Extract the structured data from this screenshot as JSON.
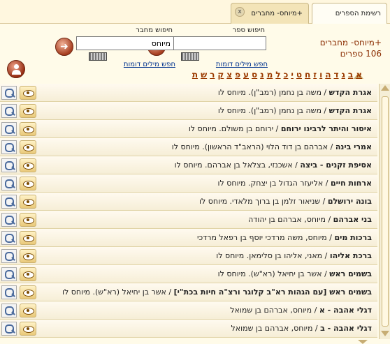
{
  "tabs": [
    {
      "label": "רשימת הספרים"
    },
    {
      "label": "+מיוחס- מחברים",
      "close": "x"
    }
  ],
  "header": {
    "collection_title": "+מיוחס- מחברים",
    "collection_count": "106 ספרים"
  },
  "book_search": {
    "label": "חיפוש ספר",
    "value": "",
    "similar_link": "חפש מילים דומות"
  },
  "author_search": {
    "label": "חיפוש מחבר",
    "value": "מיוחס",
    "similar_link": "חפש מילים דומות"
  },
  "alphabet": [
    "א",
    "ב",
    "ג",
    "ד",
    "ה",
    "ו",
    "ז",
    "ח",
    "ט",
    "י",
    "כ",
    "ל",
    "מ",
    "נ",
    "ס",
    "ע",
    "פ",
    "צ",
    "ק",
    "ר",
    "ש",
    "ת"
  ],
  "rows": [
    {
      "title": "אגרת הקדש",
      "rest": " / משה בן נחמן (רמב\"ן). מיוחס לו"
    },
    {
      "title": "אגרת הקדש",
      "rest": " / משה בן נחמן (רמב\"ן). מיוחס לו"
    },
    {
      "title": "איסור והיתר לרבינו ירוחם",
      "rest": " / ירוחם בן משולם. מיוחס לו"
    },
    {
      "title": "אמרי בינה",
      "rest": " / אברהם בן דוד הלוי (הראב\"ד הראשון). מיוחס לו"
    },
    {
      "title": "אסיפת זקנים - ביצה",
      "rest": " / אשכנזי, בצלאל בן אברהם. מיוחס לו"
    },
    {
      "title": "ארחות חיים",
      "rest": " / אליעזר הגדול בן יצחק. מיוחס לו"
    },
    {
      "title": "בונה ירושלם",
      "rest": " / שניאור זלמן בן ברוך מלאדי. מיוחס לו"
    },
    {
      "title": "בני אברהם",
      "rest": " / מיוחס, אברהם בן יהודה"
    },
    {
      "title": "ברכות מים",
      "rest": " / מיוחס, משה מרדכי יוסף בן רפאל מרדכי"
    },
    {
      "title": "ברכת אליהו",
      "rest": " / מאני, אליהו בן סלימאן. מיוחס לו"
    },
    {
      "title": "בשמים ראש",
      "rest": " / אשר בן יחיאל (רא\"ש). מיוחס לו"
    },
    {
      "title": "בשמים ראש [עם הגהות רא\"ב קלוגר ורצ\"ה חיות בכת\"י]",
      "rest": " / אשר בן יחיאל (רא\"ש). מיוחס לו"
    },
    {
      "title": "דגלי אהבה - א",
      "rest": " / מיוחס, אברהם בן שמואל"
    },
    {
      "title": "דגלי אהבה - ב",
      "rest": " / מיוחס, אברהם בן שמואל"
    }
  ]
}
